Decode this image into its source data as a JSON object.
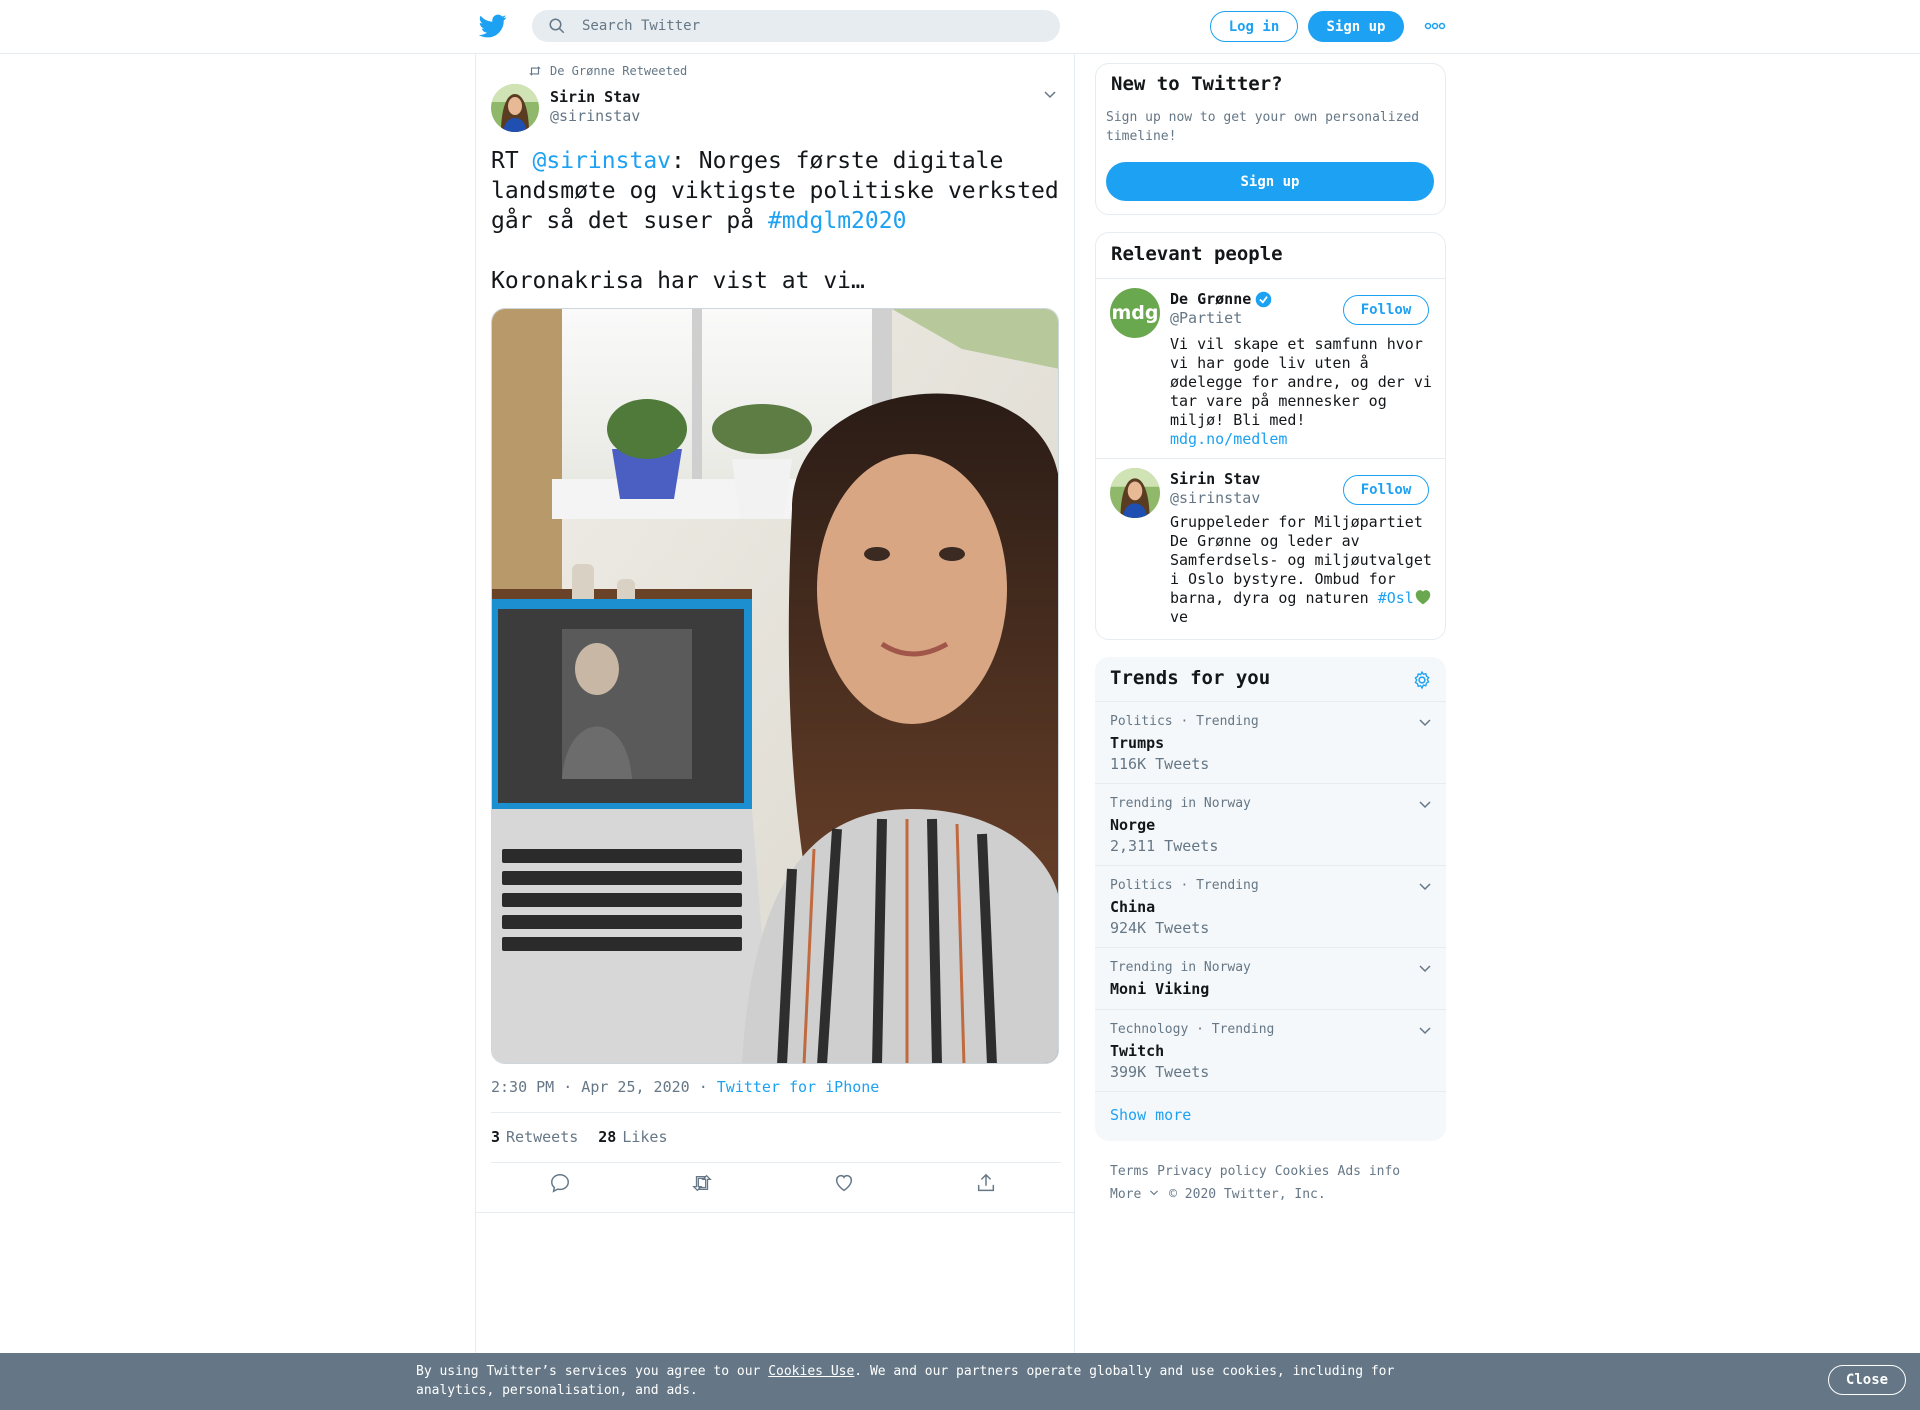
{
  "header": {
    "search_placeholder": "Search Twitter",
    "login_label": "Log in",
    "signup_label": "Sign up"
  },
  "tweet": {
    "retweeted_by": "De Grønne Retweeted",
    "author_name": "Sirin Stav",
    "author_handle": "@sirinstav",
    "text_prefix": "RT ",
    "mention": "@sirinstav",
    "text_middle": ": Norges første digitale landsmøte og viktigste politiske verksted går så det suser på ",
    "hashtag": "#mdglm2020",
    "text_second": "Koronakrisa har vist at vi…",
    "timestamp": "2:30 PM · Apr 25, 2020",
    "separator": " · ",
    "source": "Twitter for iPhone",
    "retweets_count": "3",
    "retweets_label": "Retweets",
    "likes_count": "28",
    "likes_label": "Likes"
  },
  "new_to_twitter": {
    "title": "New to Twitter?",
    "description": "Sign up now to get your own personalized timeline!",
    "button_label": "Sign up"
  },
  "relevant_people": {
    "title": "Relevant people",
    "people": [
      {
        "name": "De Grønne",
        "handle": "@Partiet",
        "avatar_text": "mdg",
        "bio": "Vi vil skape et samfunn hvor vi har gode liv uten å ødelegge for andre, og der vi tar vare på mennesker og miljø! Bli med!",
        "link": "mdg.no/medlem",
        "follow_label": "Follow"
      },
      {
        "name": "Sirin Stav",
        "handle": "@sirinstav",
        "bio_pre": "Gruppeleder for Miljøpartiet De Grønne og leder av Samferdsels- og miljøutvalget i Oslo bystyre. Ombud for barna, dyra og naturen ",
        "bio_tag": "#Osl",
        "bio_post": "ve",
        "follow_label": "Follow"
      }
    ]
  },
  "trends": {
    "title": "Trends for you",
    "items": [
      {
        "context": "Politics · Trending",
        "name": "Trumps",
        "count": "116K Tweets"
      },
      {
        "context": "Trending in Norway",
        "name": "Norge",
        "count": "2,311 Tweets"
      },
      {
        "context": "Politics · Trending",
        "name": "China",
        "count": "924K Tweets"
      },
      {
        "context": "Trending in Norway",
        "name": "Moni Viking",
        "count": ""
      },
      {
        "context": "Technology · Trending",
        "name": "Twitch",
        "count": "399K Tweets"
      }
    ],
    "show_more": "Show more"
  },
  "footer": {
    "terms": "Terms",
    "privacy": "Privacy policy",
    "cookies": "Cookies",
    "ads": "Ads info",
    "more": "More",
    "copyright": "© 2020 Twitter, Inc."
  },
  "cookie_bar": {
    "text_pre": "By using Twitter’s services you agree to our ",
    "link": "Cookies Use",
    "text_post": ". We and our partners operate globally and use cookies, including for analytics, personalisation, and ads.",
    "close_label": "Close"
  },
  "colors": {
    "accent": "#1da1f2",
    "secondary_text": "#657786",
    "mdg_green": "#6aa84f"
  }
}
